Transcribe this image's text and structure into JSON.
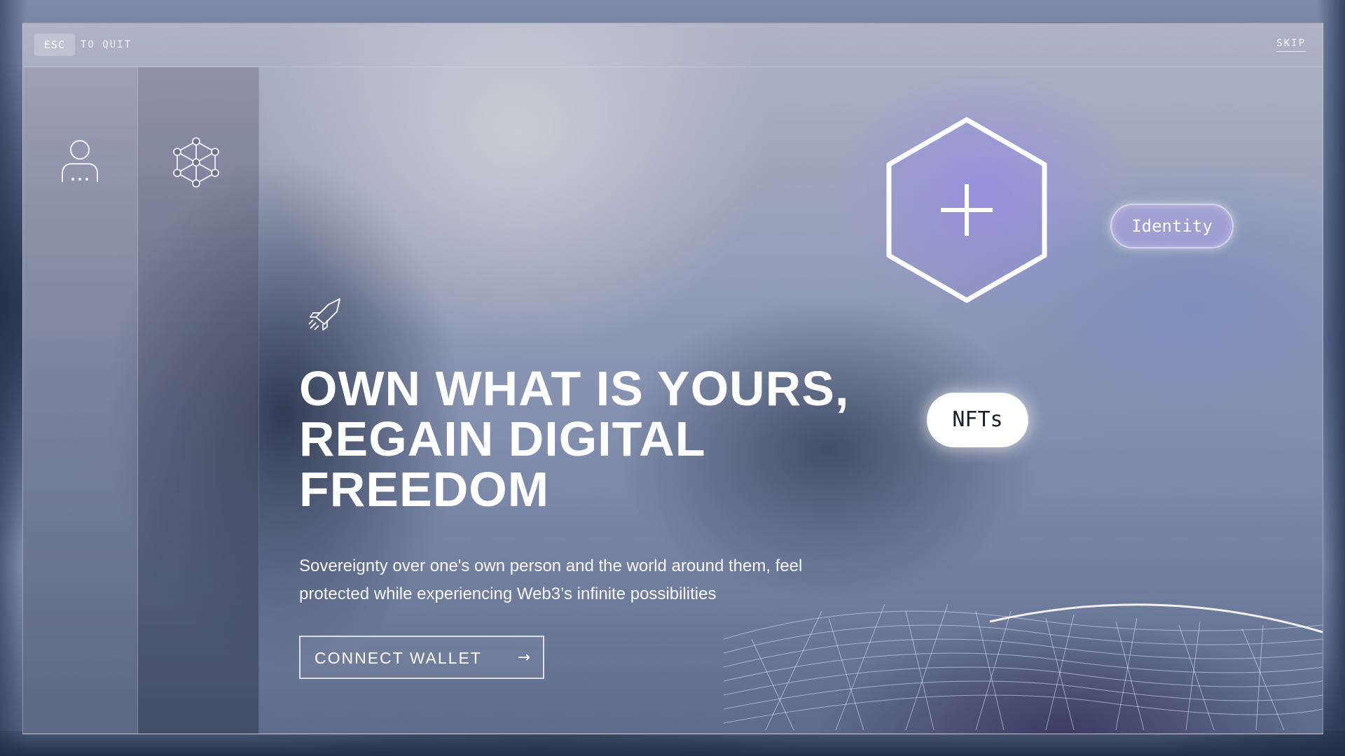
{
  "topbar": {
    "esc_key": "ESC",
    "quit_label": "TO QUIT",
    "skip_label": "SKIP"
  },
  "sidebar": {
    "icons": [
      "user-icon",
      "network-cube-icon"
    ]
  },
  "hero": {
    "icon": "rocket-icon",
    "headline": "OWN WHAT IS YOURS, REGAIN DIGITAL FREEDOM",
    "subline": "Sovereignty over one's own person and the world around them, feel protected while experiencing Web3’s infinite possibilities",
    "cta_label": "CONNECT WALLET",
    "cta_icon": "arrow-right-icon"
  },
  "features": {
    "hex_icon": "plus-icon",
    "identity_label": "Identity",
    "nfts_label": "NFTs"
  },
  "colors": {
    "accent_glow": "#9d8fe6",
    "text": "#ffffff",
    "pill_dark_text": "#1a1f2e"
  }
}
